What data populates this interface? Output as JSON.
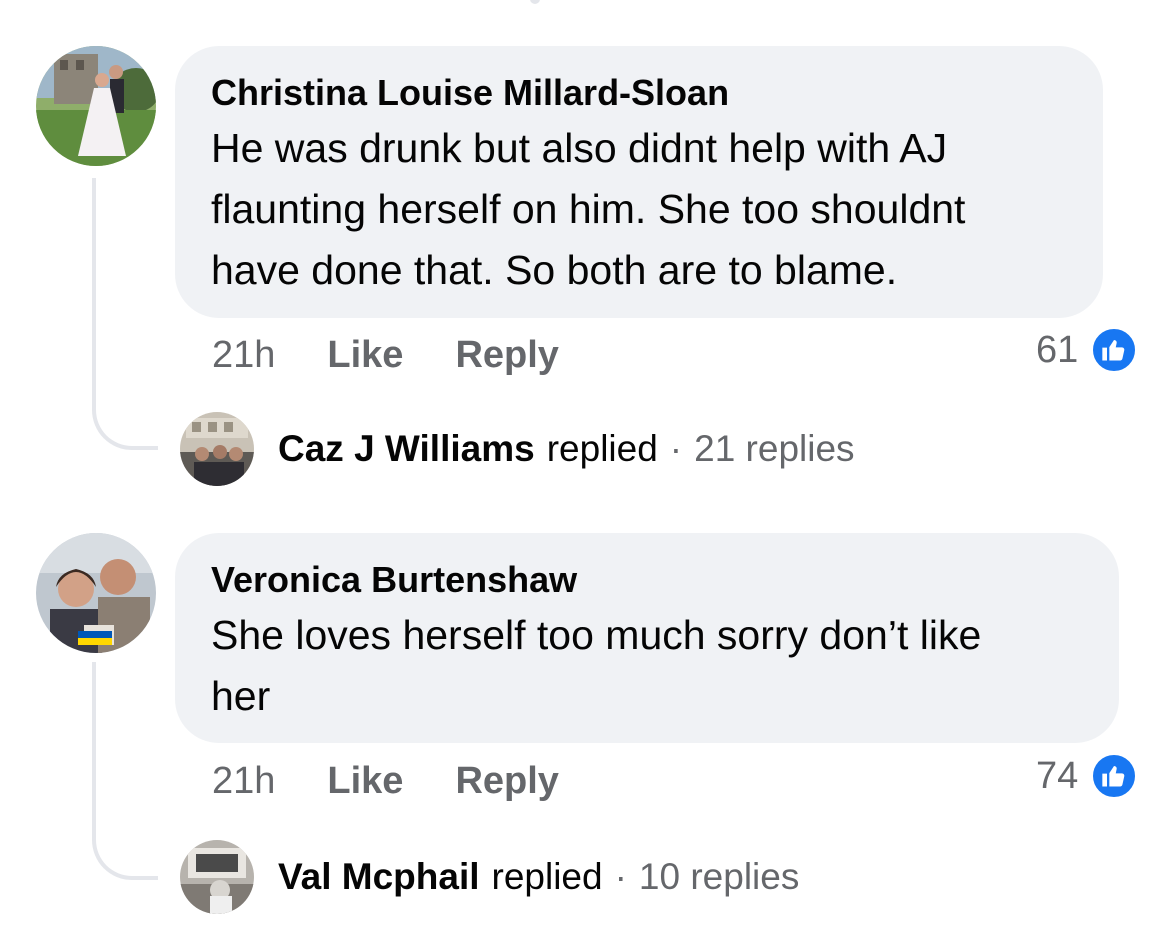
{
  "comments": [
    {
      "author": "Christina Louise Millard-Sloan",
      "text_lines": [
        "He was drunk but also didnt help with AJ",
        "flaunting herself on him. She too shouldnt",
        "have done that. So both are to blame."
      ],
      "time": "21h",
      "like_label": "Like",
      "reply_label": "Reply",
      "reaction_count": "61",
      "reaction_icon": "like-icon",
      "reply_preview": {
        "name": "Caz J Williams",
        "action": "replied",
        "separator": "·",
        "count": "21 replies"
      }
    },
    {
      "author": "Veronica Burtenshaw",
      "text_lines": [
        "She loves herself too much sorry don’t like",
        "her"
      ],
      "time": "21h",
      "like_label": "Like",
      "reply_label": "Reply",
      "reaction_count": "74",
      "reaction_icon": "like-icon",
      "reply_preview": {
        "name": "Val Mcphail",
        "action": "replied",
        "separator": "·",
        "count": "10 replies"
      }
    }
  ],
  "colors": {
    "bubble": "#f0f2f5",
    "secondary_text": "#65676b",
    "like_blue": "#1877f2",
    "thread_line": "#e4e6eb"
  }
}
